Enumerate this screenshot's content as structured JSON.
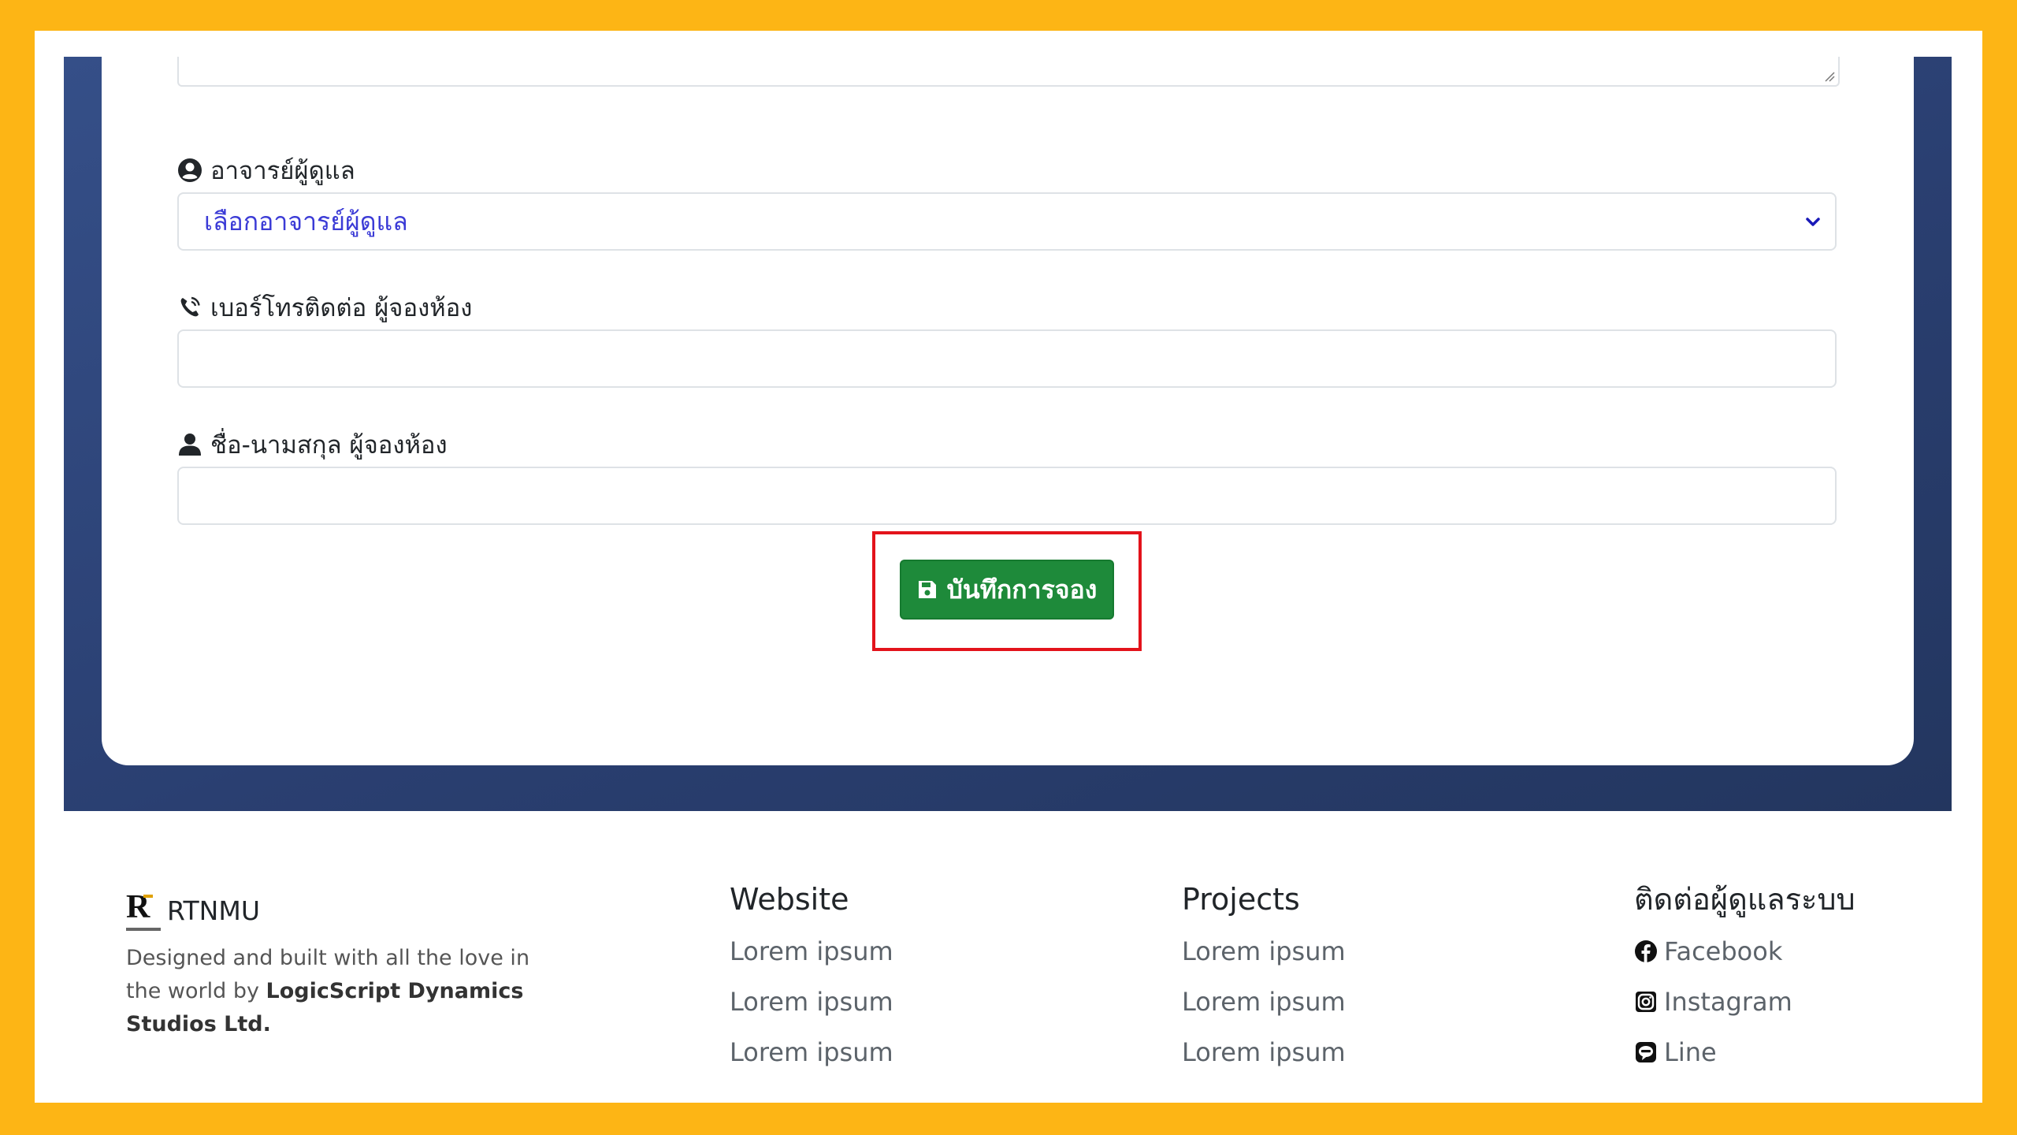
{
  "form": {
    "advisor_label": "อาจารย์ผู้ดูแล",
    "advisor_select_value": "เลือกอาจารย์ผู้ดูแล",
    "phone_label": "เบอร์โทรติดต่อ ผู้จองห้อง",
    "phone_value": "",
    "name_label": "ชื่อ-นามสกุล ผู้จองห้อง",
    "name_value": "",
    "save_label": "บันทึกการจอง"
  },
  "footer": {
    "brand_name": "RTNMU",
    "about_prefix": "Designed and built with all the love in the world by ",
    "about_company": "LogicScript Dynamics Studios Ltd.",
    "columns": [
      {
        "title": "Website",
        "links": [
          "Lorem ipsum",
          "Lorem ipsum",
          "Lorem ipsum"
        ]
      },
      {
        "title": "Projects",
        "links": [
          "Lorem ipsum",
          "Lorem ipsum",
          "Lorem ipsum"
        ]
      },
      {
        "title": "ติดต่อผู้ดูแลระบบ",
        "links": [
          "Facebook",
          "Instagram",
          "Line"
        ]
      }
    ]
  },
  "icons": {
    "advisor": "user-circle-icon",
    "phone": "phone-volume-icon",
    "name": "user-icon",
    "save": "floppy-disk-icon",
    "select": "chevron-down-icon",
    "facebook": "facebook-icon",
    "instagram": "instagram-icon",
    "line": "line-icon"
  },
  "colors": {
    "frame": "#FDB515",
    "hero": "#2f4578",
    "save_button": "#1e8a3a",
    "highlight": "#e3131b",
    "select_text": "#3b3bd6"
  }
}
